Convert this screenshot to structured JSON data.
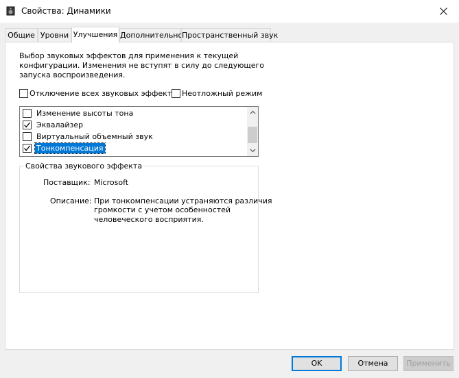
{
  "window": {
    "title": "Свойства: Динамики"
  },
  "tabs": [
    {
      "label": "Общие"
    },
    {
      "label": "Уровни"
    },
    {
      "label": "Улучшения",
      "active": true
    },
    {
      "label": "Дополнительно"
    },
    {
      "label": "Пространственный звук"
    }
  ],
  "enhancements": {
    "description_lines": [
      "Выбор звуковых эффектов для применения к текущей",
      "конфигурации. Изменения не вступят в силу до следующего",
      "запуска воспроизведения."
    ],
    "disable_all": {
      "label": "Отключение всех звуковых эффектов",
      "checked": false
    },
    "immediate_mode": {
      "label": "Неотложный режим",
      "checked": false
    },
    "effects": [
      {
        "label": "Изменение высоты тона",
        "checked": false,
        "selected": false
      },
      {
        "label": "Эквалайзер",
        "checked": true,
        "selected": false
      },
      {
        "label": "Виртуальный объемный звук",
        "checked": false,
        "selected": false
      },
      {
        "label": "Тонкомпенсация",
        "checked": true,
        "selected": true
      }
    ],
    "properties": {
      "caption": "Свойства звукового эффекта",
      "provider_label": "Поставщик:",
      "provider_value": "Microsoft",
      "description_label": "Описание:",
      "description_lines": [
        "При тонкомпенсации устраняются различия",
        "громкости с учетом особенностей",
        "человеческого восприятия."
      ]
    }
  },
  "buttons": {
    "ok": "OK",
    "cancel": "Отмена",
    "apply": "Применить"
  },
  "colors": {
    "selection": "#0078d7",
    "default_button_border": "#0078d7"
  }
}
